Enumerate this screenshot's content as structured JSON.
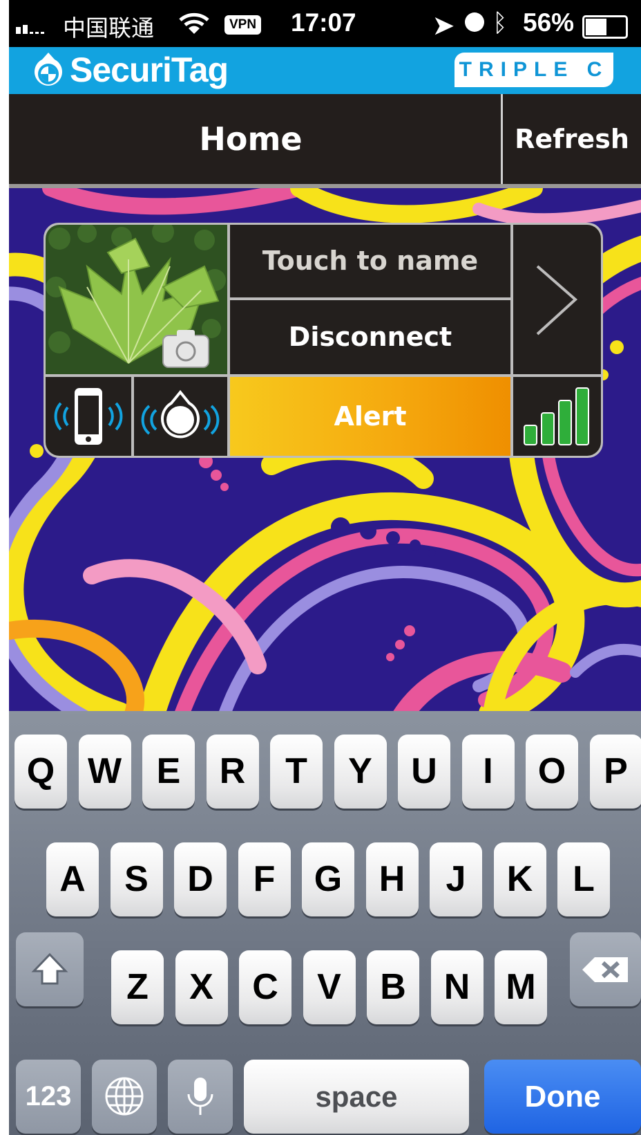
{
  "status_bar": {
    "carrier": "中国联通",
    "vpn": "VPN",
    "time": "17:07",
    "battery": "56%",
    "icons": [
      "signal-icon",
      "wifi-icon",
      "location-arrow-icon",
      "alarm-clock-icon",
      "bluetooth-icon",
      "battery-icon"
    ]
  },
  "brand": {
    "app_name": "SecuriTag",
    "partner": "TRIPLE C"
  },
  "nav": {
    "title": "Home",
    "refresh": "Refresh"
  },
  "tag": {
    "name_prompt": "Touch to name",
    "disconnect": "Disconnect",
    "alert": "Alert",
    "signal_bars": 4,
    "signal_bars_total": 4,
    "icons": [
      "camera-icon",
      "chevron-right-icon",
      "phone-ring-icon",
      "tag-ring-icon",
      "signal-strength-icon"
    ]
  },
  "keyboard": {
    "row1": [
      "Q",
      "W",
      "E",
      "R",
      "T",
      "Y",
      "U",
      "I",
      "O",
      "P"
    ],
    "row2": [
      "A",
      "S",
      "D",
      "F",
      "G",
      "H",
      "J",
      "K",
      "L"
    ],
    "row3": [
      "Z",
      "X",
      "C",
      "V",
      "B",
      "N",
      "M"
    ],
    "numbers": "123",
    "space": "space",
    "done": "Done"
  },
  "colors": {
    "brand_blue": "#12a3e0",
    "nav_dark": "#231e1c",
    "alert_orange": "#f5a80e",
    "signal_green": "#2fae3a",
    "done_blue": "#1f64e3"
  }
}
